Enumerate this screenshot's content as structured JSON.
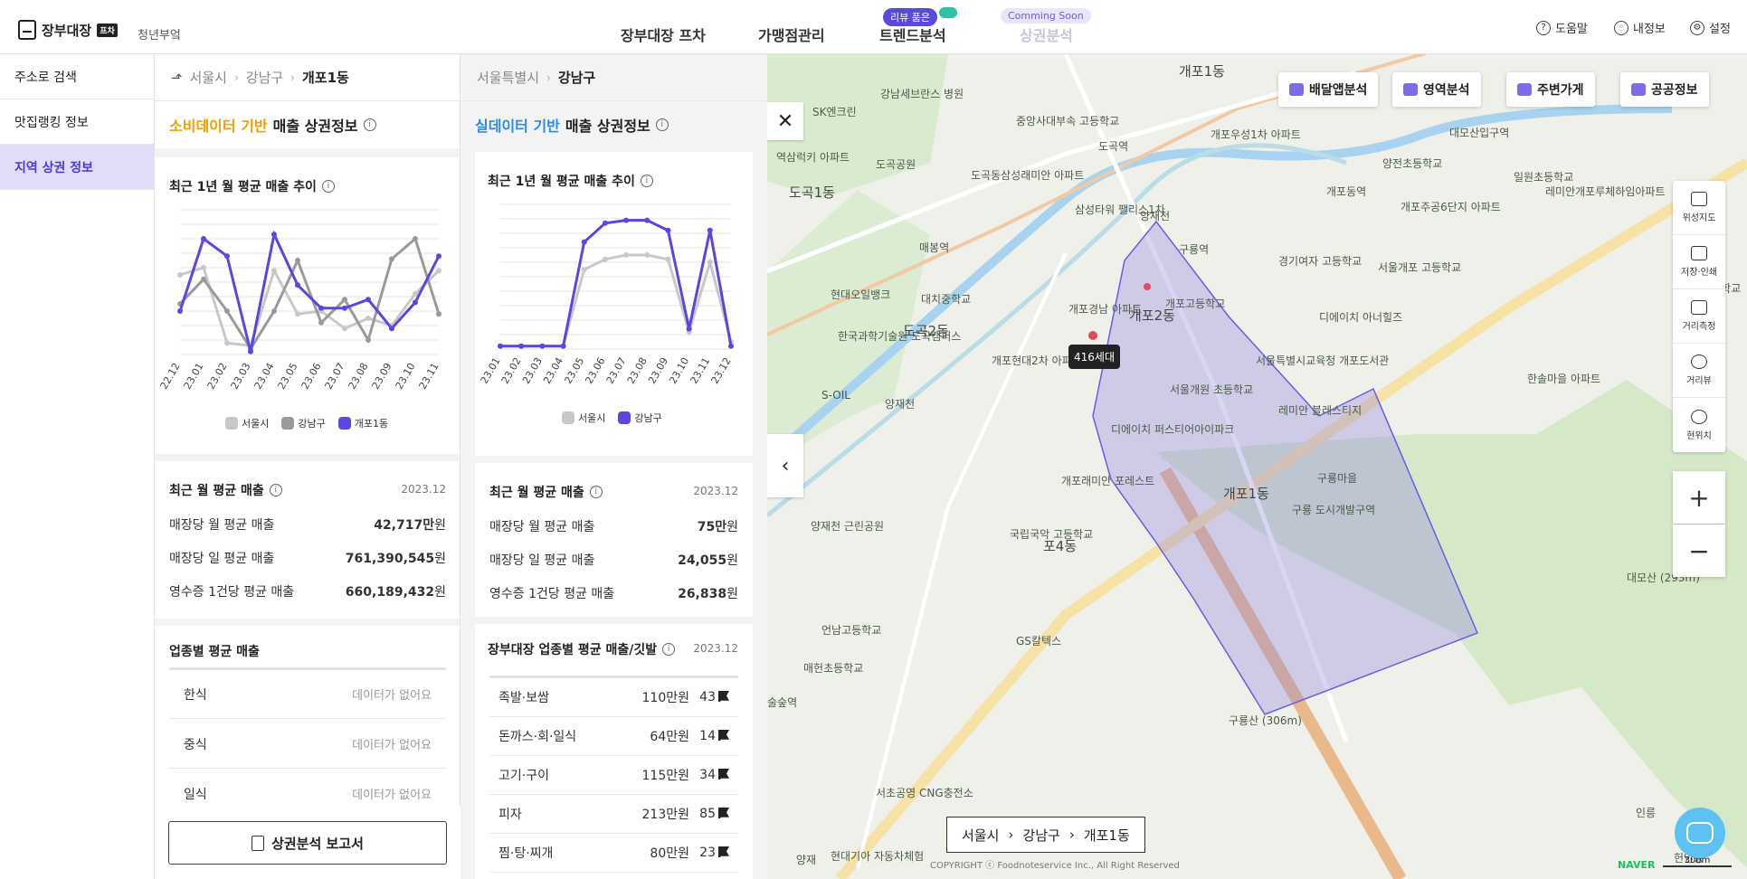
{
  "brand": {
    "name": "장부대장",
    "badge": "프차",
    "sub": "청년부엌"
  },
  "nav": [
    {
      "label": "장부대장 프차"
    },
    {
      "label": "가맹점관리"
    },
    {
      "label": "트렌드분석",
      "badge": "리뷰 품은"
    },
    {
      "label": "상권분석",
      "badge": "Comming Soon"
    }
  ],
  "util": {
    "help": "도움말",
    "my": "내정보",
    "settings": "설정"
  },
  "leftnav": [
    {
      "label": "주소로 검색"
    },
    {
      "label": "맛집랭킹 정보"
    },
    {
      "label": "지역 상권 정보"
    }
  ],
  "panel1": {
    "crumb": [
      "서울시",
      "강남구",
      "개포1동"
    ],
    "head_accent": "소비데이터 기반",
    "head_rest": "매출 상권정보",
    "trend_title": "최근 1년 월 평균 매출 추이",
    "avg_title": "최근 월 평균 매출",
    "avg_date": "2023.12",
    "avg_rows": [
      {
        "k": "매장당 월 평균 매출",
        "v": "42,717만",
        "u": "원"
      },
      {
        "k": "매장당 일 평균 매출",
        "v": "761,390,545",
        "u": "원"
      },
      {
        "k": "영수증 1건당 평균 매출",
        "v": "660,189,432",
        "u": "원"
      }
    ],
    "industry_title": "업종별 평균 매출",
    "industry_rows": [
      {
        "name": "한식",
        "val": "데이터가 없어요"
      },
      {
        "name": "중식",
        "val": "데이터가 없어요"
      },
      {
        "name": "일식",
        "val": "데이터가 없어요"
      }
    ],
    "report": "상권분석 보고서"
  },
  "panel2": {
    "crumb": [
      "서울특별시",
      "강남구"
    ],
    "head_accent": "실데이터 기반",
    "head_rest": "매출 상권정보",
    "trend_title": "최근 1년 월 평균 매출 추이",
    "avg_title": "최근 월 평균 매출",
    "avg_date": "2023.12",
    "avg_rows": [
      {
        "k": "매장당 월 평균 매출",
        "v": "75만",
        "u": "원"
      },
      {
        "k": "매장당 일 평균 매출",
        "v": "24,055",
        "u": "원"
      },
      {
        "k": "영수증 1건당 평균 매출",
        "v": "26,838",
        "u": "원"
      }
    ],
    "industry_title": "장부대장 업종별 평균 매출/깃발",
    "industry_date": "2023.12",
    "industry_rows": [
      {
        "name": "족발·보쌈",
        "amt": "110만원",
        "cnt": "43"
      },
      {
        "name": "돈까스·회·일식",
        "amt": "64만원",
        "cnt": "14"
      },
      {
        "name": "고기·구이",
        "amt": "115만원",
        "cnt": "34"
      },
      {
        "name": "피자",
        "amt": "213만원",
        "cnt": "85"
      },
      {
        "name": "찜·탕·찌개",
        "amt": "80만원",
        "cnt": "23"
      }
    ]
  },
  "chart_data": [
    {
      "type": "line",
      "categories": [
        "22.12",
        "23.01",
        "23.02",
        "23.03",
        "23.04",
        "23.05",
        "23.06",
        "23.07",
        "23.08",
        "23.09",
        "23.10",
        "23.11"
      ],
      "legend_position": "bottom",
      "grid": true,
      "series": [
        {
          "name": "서울시",
          "color": "#c8c8c8",
          "values": [
            55,
            60,
            8,
            6,
            58,
            28,
            30,
            18,
            25,
            20,
            42,
            58
          ]
        },
        {
          "name": "강남구",
          "color": "#9a9a9a",
          "values": [
            35,
            52,
            30,
            4,
            30,
            65,
            22,
            38,
            10,
            66,
            80,
            28
          ]
        },
        {
          "name": "개포1동",
          "color": "#5a47e0",
          "values": [
            30,
            80,
            68,
            2,
            83,
            48,
            32,
            32,
            38,
            18,
            36,
            68
          ]
        }
      ]
    },
    {
      "type": "line",
      "categories": [
        "23.01",
        "23.02",
        "23.03",
        "23.04",
        "23.05",
        "23.06",
        "23.07",
        "23.08",
        "23.09",
        "23.10",
        "23.11",
        "23.12"
      ],
      "legend_position": "bottom",
      "grid": true,
      "series": [
        {
          "name": "서울시",
          "color": "#c8c8c8",
          "values": [
            2,
            2,
            2,
            2,
            55,
            62,
            65,
            65,
            62,
            12,
            60,
            5
          ]
        },
        {
          "name": "강남구",
          "color": "#5a47e0",
          "values": [
            2,
            2,
            2,
            2,
            74,
            87,
            89,
            89,
            82,
            14,
            82,
            2
          ]
        }
      ]
    }
  ],
  "map": {
    "tools": [
      "배달앱분석",
      "영역분석",
      "주변가게",
      "공공정보"
    ],
    "side": [
      "위성지도",
      "저장·인쇄",
      "거리측정",
      "거리뷰",
      "현위치"
    ],
    "household": "416세대",
    "crumb": [
      "서울시",
      "강남구",
      "개포1동"
    ],
    "copyright": "COPYRIGHT ⓒ Foodnoteservice Inc., All Right Reserved",
    "naver": "NAVER",
    "scale": "300m",
    "labels": [
      {
        "t": "개포1동",
        "x": 504,
        "y": 475,
        "big": true
      },
      {
        "t": "도곡1동",
        "x": 24,
        "y": 142,
        "big": true
      },
      {
        "t": "도곡2동",
        "x": 150,
        "y": 295,
        "big": true
      },
      {
        "t": "개포2동",
        "x": 400,
        "y": 278,
        "big": true
      },
      {
        "t": "포4동",
        "x": 305,
        "y": 533,
        "big": true
      },
      {
        "t": "개포1동",
        "x": 455,
        "y": 8,
        "big": true
      },
      {
        "t": "도곡역",
        "x": 366,
        "y": 93
      },
      {
        "t": "매봉역",
        "x": 168,
        "y": 205
      },
      {
        "t": "구룡역",
        "x": 455,
        "y": 207
      },
      {
        "t": "개포동역",
        "x": 618,
        "y": 143
      },
      {
        "t": "대모산입구역",
        "x": 754,
        "y": 78
      },
      {
        "t": "양재천",
        "x": 412,
        "y": 170
      },
      {
        "t": "양재천",
        "x": 130,
        "y": 378
      },
      {
        "t": "구룡마을",
        "x": 608,
        "y": 460
      },
      {
        "t": "구룡 도시개발구역",
        "x": 580,
        "y": 495
      },
      {
        "t": "개포경남 아파트",
        "x": 333,
        "y": 273
      },
      {
        "t": "디에이치 퍼스티어아이파크",
        "x": 380,
        "y": 406
      },
      {
        "t": "개포래미안 포레스트",
        "x": 325,
        "y": 463
      },
      {
        "t": "국립국악 고등학교",
        "x": 268,
        "y": 522
      },
      {
        "t": "서울개원 초등학교",
        "x": 445,
        "y": 362
      },
      {
        "t": "개포고등학교",
        "x": 440,
        "y": 267
      },
      {
        "t": "경기여자 고등학교",
        "x": 565,
        "y": 220
      },
      {
        "t": "서울개포 고등학교",
        "x": 675,
        "y": 227
      },
      {
        "t": "양전초등학교",
        "x": 680,
        "y": 112
      },
      {
        "t": "일원초등학교",
        "x": 825,
        "y": 127
      },
      {
        "t": "레미안 블레스티지",
        "x": 565,
        "y": 385
      },
      {
        "t": "디에이치 아너힐즈",
        "x": 610,
        "y": 282
      },
      {
        "t": "서울특별시교육청 개포도서관",
        "x": 540,
        "y": 330
      },
      {
        "t": "구룡산 (306m)",
        "x": 510,
        "y": 728
      },
      {
        "t": "대모산 (293m)",
        "x": 950,
        "y": 570
      },
      {
        "t": "SK엔크린",
        "x": 50,
        "y": 55
      },
      {
        "t": "도곡공원",
        "x": 120,
        "y": 113
      },
      {
        "t": "현대오일뱅크",
        "x": 70,
        "y": 257
      },
      {
        "t": "한국과학기술원 도곡캠퍼스",
        "x": 78,
        "y": 303
      },
      {
        "t": "S-OIL",
        "x": 60,
        "y": 370
      },
      {
        "t": "양재천 근린공원",
        "x": 48,
        "y": 513
      },
      {
        "t": "언남고등학교",
        "x": 60,
        "y": 628
      },
      {
        "t": "매헌초등학교",
        "x": 40,
        "y": 670
      },
      {
        "t": "서초공영 CNG충전소",
        "x": 120,
        "y": 808
      },
      {
        "t": "현대기아 자동차체험",
        "x": 70,
        "y": 878
      },
      {
        "t": "GS칼텍스",
        "x": 275,
        "y": 640
      },
      {
        "t": "삼성타워 팰리스1차",
        "x": 340,
        "y": 163
      },
      {
        "t": "도곡동삼성래미안 아파트",
        "x": 225,
        "y": 125
      },
      {
        "t": "중앙사대부속 고등학교",
        "x": 275,
        "y": 65
      },
      {
        "t": "개포현대2차 아파트",
        "x": 248,
        "y": 330
      },
      {
        "t": "대치중학교",
        "x": 170,
        "y": 262
      },
      {
        "t": "강남세브란스 병원",
        "x": 125,
        "y": 35
      },
      {
        "t": "역삼럭키 아파트",
        "x": 10,
        "y": 105
      },
      {
        "t": "개포우성1차 아파트",
        "x": 490,
        "y": 80
      },
      {
        "t": "개포주공6단지 아파트",
        "x": 700,
        "y": 160
      },
      {
        "t": "레미안개포루체하임아파트",
        "x": 860,
        "y": 143
      },
      {
        "t": "한솔마을 아파트",
        "x": 840,
        "y": 350
      },
      {
        "t": "증산고등학교",
        "x": 1010,
        "y": 250
      },
      {
        "t": "인릉",
        "x": 960,
        "y": 830
      },
      {
        "t": "헌인릉",
        "x": 1002,
        "y": 880
      },
      {
        "t": "양재",
        "x": 32,
        "y": 882
      },
      {
        "t": "술숲역",
        "x": 0,
        "y": 708
      }
    ]
  }
}
